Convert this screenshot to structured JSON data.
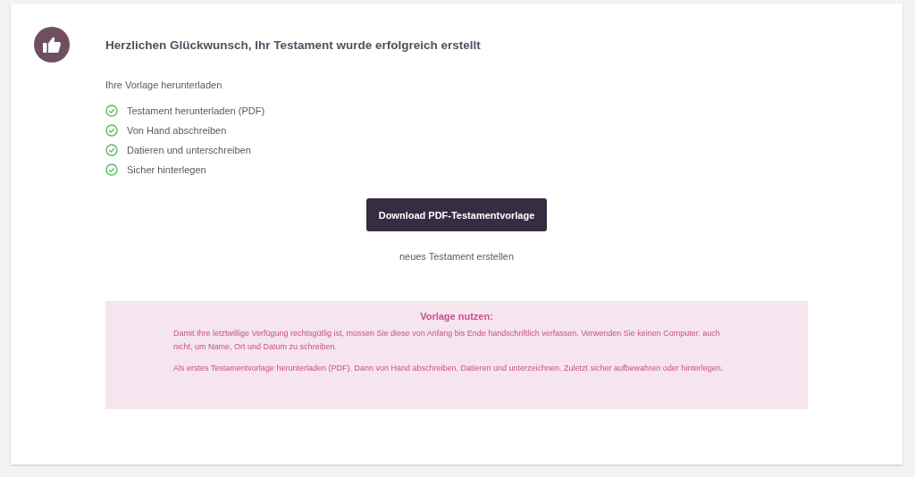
{
  "title": "Herzlichen Glückwunsch, Ihr Testament wurde erfolgreich erstellt",
  "subtitle": "Ihre Vorlage herunterladen",
  "steps": [
    {
      "label": "Testament herunterladen (PDF)"
    },
    {
      "label": "Von Hand abschreiben"
    },
    {
      "label": "Datieren und unterschreiben"
    },
    {
      "label": "Sicher hinterlegen"
    }
  ],
  "download_button": "Download PDF-Testamentvorlage",
  "new_link": "neues Testament erstellen",
  "notice": {
    "heading": "Vorlage nutzen:",
    "paragraphs": [
      "Damit Ihre letztwillige Verfügung rechtsgütlig ist, müssen Sie diese von Anfang bis Ende handschriftlich verfassen. Verwenden Sie keinen Computer. auch nicht, um Name, Ort und Datum zu schreiben.",
      "Als erstes Testamentvorlage herunterladen (PDF). Dann von Hand abschreiben, Datieren und unterzeichnen. Zuletzt sicher aufbewahren oder hinterlegen."
    ]
  }
}
